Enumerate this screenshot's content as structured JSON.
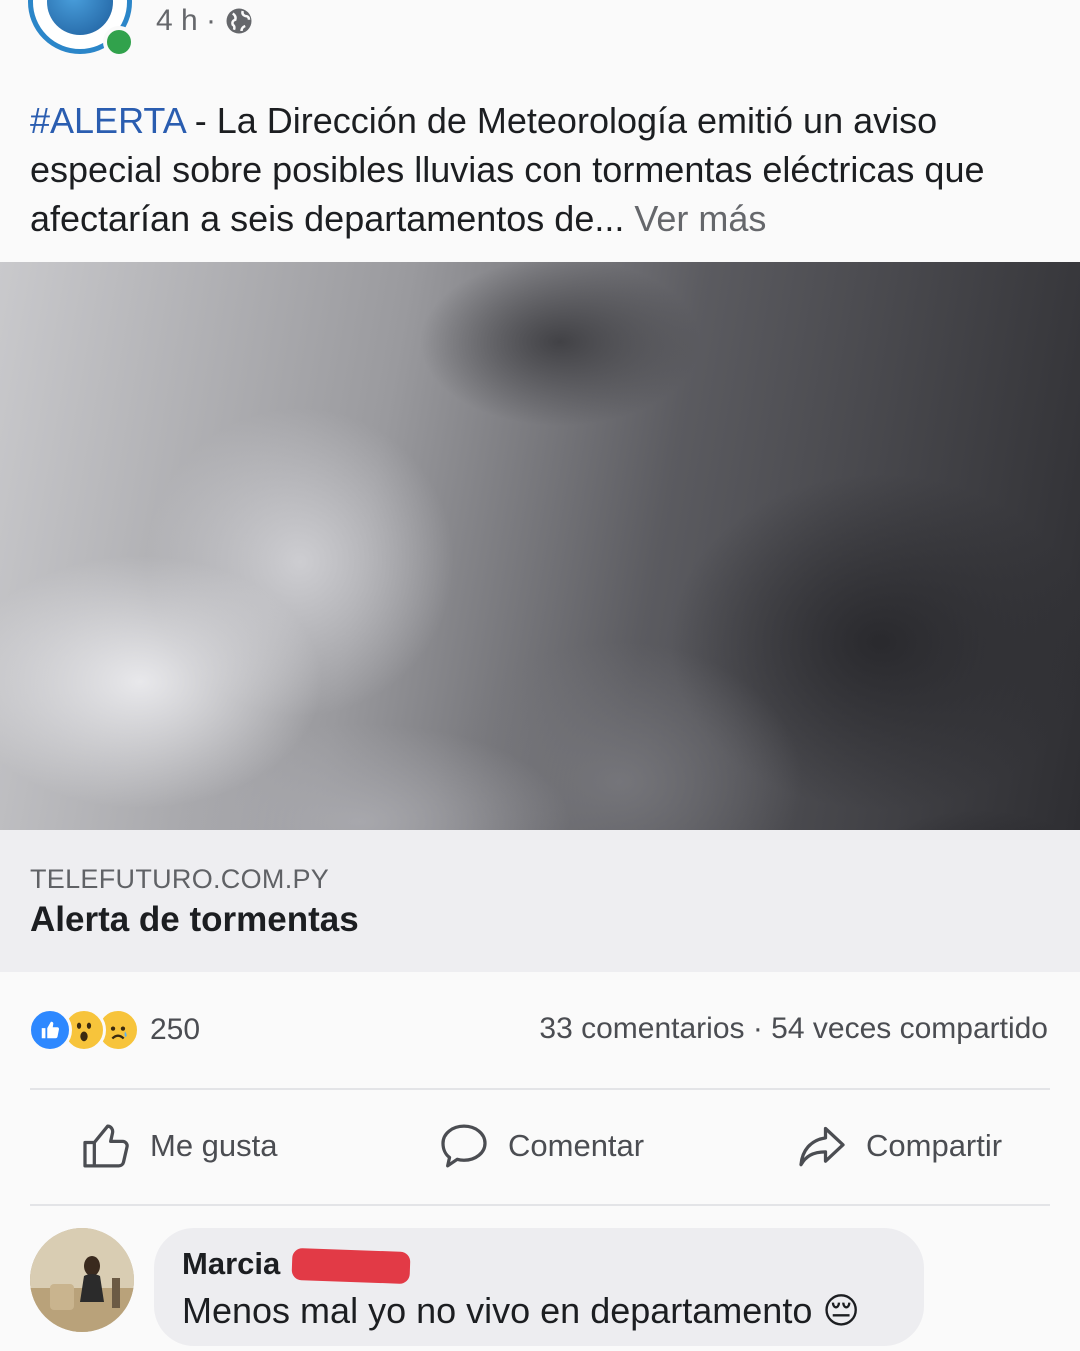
{
  "header": {
    "timestamp": "4 h ·"
  },
  "post": {
    "hashtag": "#ALERTA",
    "body": " - La Dirección de Meteorología emitió un aviso especial sobre posibles lluvias con tormentas eléctricas que afectarían a seis departamentos de...",
    "see_more": "Ver más"
  },
  "link_card": {
    "domain": "TELEFUTURO.COM.PY",
    "title": "Alerta de tormentas"
  },
  "engagement": {
    "reactions": [
      "like-icon",
      "wow-icon",
      "sad-icon"
    ],
    "reaction_count": "250",
    "stats": "33 comentarios · 54 veces compartido"
  },
  "actions": {
    "like": "Me gusta",
    "comment": "Comentar",
    "share": "Compartir"
  },
  "comment": {
    "author": "Marcia",
    "text": "Menos mal yo no vivo en departamento 😔"
  },
  "colors": {
    "hashtag": "#2a5db0",
    "like_blue": "#2d88ff",
    "online_green": "#31a24c",
    "redaction_red": "#e23a46"
  }
}
